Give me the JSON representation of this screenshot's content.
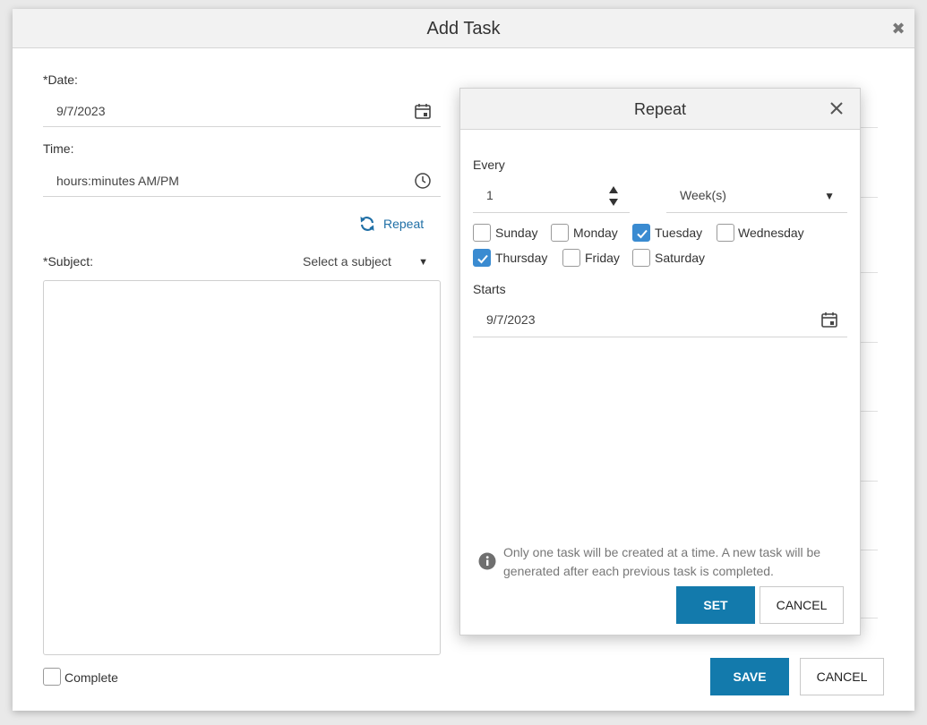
{
  "dialog": {
    "title": "Add Task",
    "close_icon": "close-icon",
    "date_label": "*Date:",
    "date_value": "9/7/2023",
    "time_label": "Time:",
    "time_placeholder": "hours:minutes AM/PM",
    "repeat_label": "Repeat",
    "subject_label": "*Subject:",
    "subject_select": "Select a subject",
    "complete_label": "Complete",
    "save_label": "SAVE",
    "cancel_label": "CANCEL"
  },
  "repeat_modal": {
    "title": "Repeat",
    "every_label": "Every",
    "every_value": "1",
    "unit_value": "Week(s)",
    "days": [
      {
        "label": "Sunday",
        "checked": false
      },
      {
        "label": "Monday",
        "checked": false
      },
      {
        "label": "Tuesday",
        "checked": true
      },
      {
        "label": "Wednesday",
        "checked": false
      },
      {
        "label": "Thursday",
        "checked": true
      },
      {
        "label": "Friday",
        "checked": false
      },
      {
        "label": "Saturday",
        "checked": false
      }
    ],
    "starts_label": "Starts",
    "starts_value": "9/7/2023",
    "info_text": "Only one task will be created at a time. A new task will be generated after each previous task is completed.",
    "set_label": "SET",
    "cancel_label": "CANCEL"
  },
  "colors": {
    "primary": "#137aac",
    "link": "#1f6fa6",
    "checked": "#3a8bd1"
  }
}
